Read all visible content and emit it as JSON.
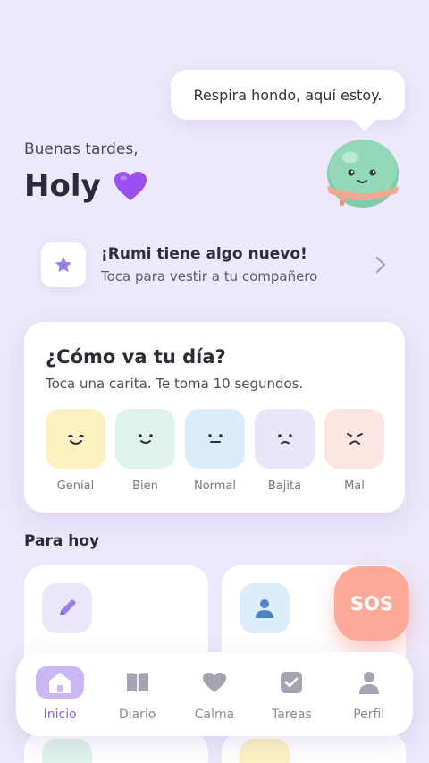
{
  "companion": {
    "speech": "Respira hondo, aquí estoy."
  },
  "greeting": {
    "salutation": "Buenas tardes,",
    "name": "Holy"
  },
  "promo": {
    "title": "¡Rumi tiene algo nuevo!",
    "subtitle": "Toca para vestir a tu compañero"
  },
  "mood": {
    "question": "¿Cómo va tu día?",
    "hint": "Toca una carita. Te toma 10 segundos.",
    "options": [
      {
        "label": "Genial",
        "color": "#fdf1c2"
      },
      {
        "label": "Bien",
        "color": "#dff4ea"
      },
      {
        "label": "Normal",
        "color": "#dbecfb"
      },
      {
        "label": "Bajita",
        "color": "#ebe5fb"
      },
      {
        "label": "Mal",
        "color": "#fde6e1"
      }
    ]
  },
  "today": {
    "title": "Para hoy"
  },
  "sos": {
    "label": "SOS"
  },
  "nav": {
    "items": [
      {
        "label": "Inicio",
        "icon": "home-icon",
        "active": true
      },
      {
        "label": "Diario",
        "icon": "book-icon"
      },
      {
        "label": "Calma",
        "icon": "heart-icon"
      },
      {
        "label": "Tareas",
        "icon": "checkbox-icon"
      },
      {
        "label": "Perfil",
        "icon": "person-icon"
      }
    ]
  },
  "colors": {
    "background": "#ede8fb",
    "accent": "#8a63e0",
    "sos": "#fca99a"
  }
}
